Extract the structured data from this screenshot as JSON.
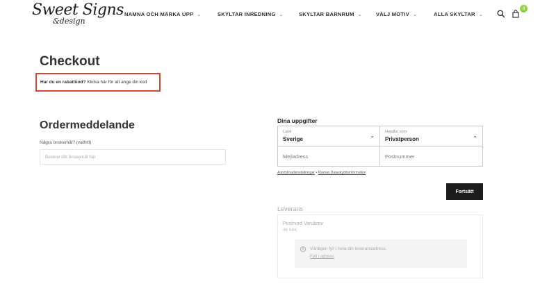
{
  "header": {
    "logo_main": "Sweet Signs",
    "logo_sub": "&design",
    "nav": [
      {
        "label": "NAMNA OCH MÄRKA UPP"
      },
      {
        "label": "SKYLTAR INREDNING"
      },
      {
        "label": "SKYLTAR BARNRUM"
      },
      {
        "label": "VÄLJ MOTIV"
      },
      {
        "label": "ALLA SKYLTAR"
      }
    ],
    "chevron_glyph": "⌄",
    "search_icon": "search-icon",
    "cart_icon": "bag-icon",
    "cart_count": "0"
  },
  "checkout": {
    "title": "Checkout",
    "coupon_question": "Har du en rabattkod?",
    "coupon_link": "Klicka här för att ange din kod"
  },
  "order_note": {
    "title": "Ordermeddelande",
    "label": "Några önskemål? (valfritt)",
    "placeholder": "Beskriv ditt önskemål här"
  },
  "details": {
    "title": "Dina uppgifter",
    "country_label": "Land",
    "country_value": "Sverige",
    "customer_type_label": "Handlar som:",
    "customer_type_value": "Privatperson",
    "email_placeholder": "Mejladress",
    "postcode_placeholder": "Postnummer",
    "autofill_link": "Autofyllnadsinställningar",
    "separator": "•",
    "privacy_link": "Klarnas Dataskyddsinformation",
    "continue_label": "Fortsätt"
  },
  "delivery": {
    "title": "Leverans",
    "method_name": "Postnord Varubrev",
    "method_price": "49 SEK",
    "notice_text": "Vänligen fyll i hela din leveransadress.",
    "notice_link": "Fyll i adress",
    "info_glyph": "i"
  },
  "colors": {
    "accent_green": "#8cd43b",
    "coupon_border": "#d9452f",
    "button_bg": "#1c1c1c"
  }
}
